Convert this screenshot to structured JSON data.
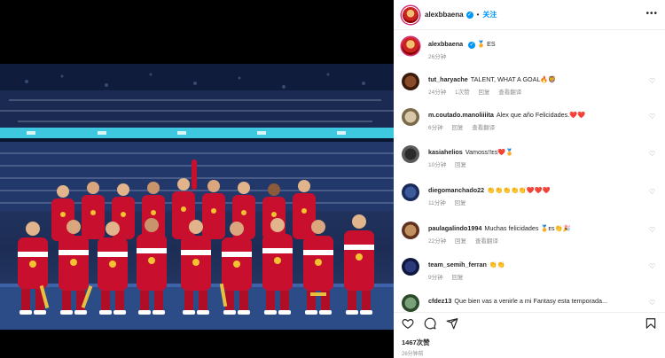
{
  "post": {
    "username": "alexbbaena",
    "verified_badge": "✓",
    "dot": "•",
    "follow_label": "关注",
    "more_label": "•••",
    "caption_suffix": "🏅 ES",
    "caption_time": "26分钟"
  },
  "comments": [
    {
      "user": "tut_haryache",
      "text": "TALENT, WHAT A GOAL🔥🦁",
      "time": "24分钟",
      "likes": "1次赞",
      "reply": "回复",
      "translate": "查看翻译"
    },
    {
      "user": "m.coutado.manoliiiita",
      "text": "Alex que año Felicidades.❤️❤️",
      "time": "6分钟",
      "likes": "",
      "reply": "回复",
      "translate": "查看翻译"
    },
    {
      "user": "kasiahelios",
      "text": "Vamoss!!ᴇs❤️🏅",
      "time": "10分钟",
      "likes": "",
      "reply": "回复",
      "translate": ""
    },
    {
      "user": "diegomanchado22",
      "text": "👏👏👏👏👏❤️❤️❤️",
      "time": "11分钟",
      "likes": "",
      "reply": "回复",
      "translate": ""
    },
    {
      "user": "paulagalindo1994",
      "text": "Muchas felicidades 🏅ᴇs👏🎉",
      "time": "22分钟",
      "likes": "",
      "reply": "回复",
      "translate": "查看翻译"
    },
    {
      "user": "team_semih_ferran",
      "text": "👏👏",
      "time": "9分钟",
      "likes": "",
      "reply": "回复",
      "translate": ""
    },
    {
      "user": "cfdez13",
      "text": "Que bien vas a venirle a mi Fantasy esta temporada...",
      "time": "",
      "likes": "",
      "reply": "",
      "translate": ""
    }
  ],
  "footer": {
    "likes": "1467次赞",
    "time": "26分钟前"
  },
  "icons": {
    "like": "heart-icon",
    "comment": "comment-icon",
    "share": "share-icon",
    "save": "bookmark-icon"
  },
  "colors": {
    "link": "#0095f6",
    "muted": "#8e8e8e",
    "uniform_red": "#c8102e",
    "uniform_gold": "#f2c230"
  }
}
